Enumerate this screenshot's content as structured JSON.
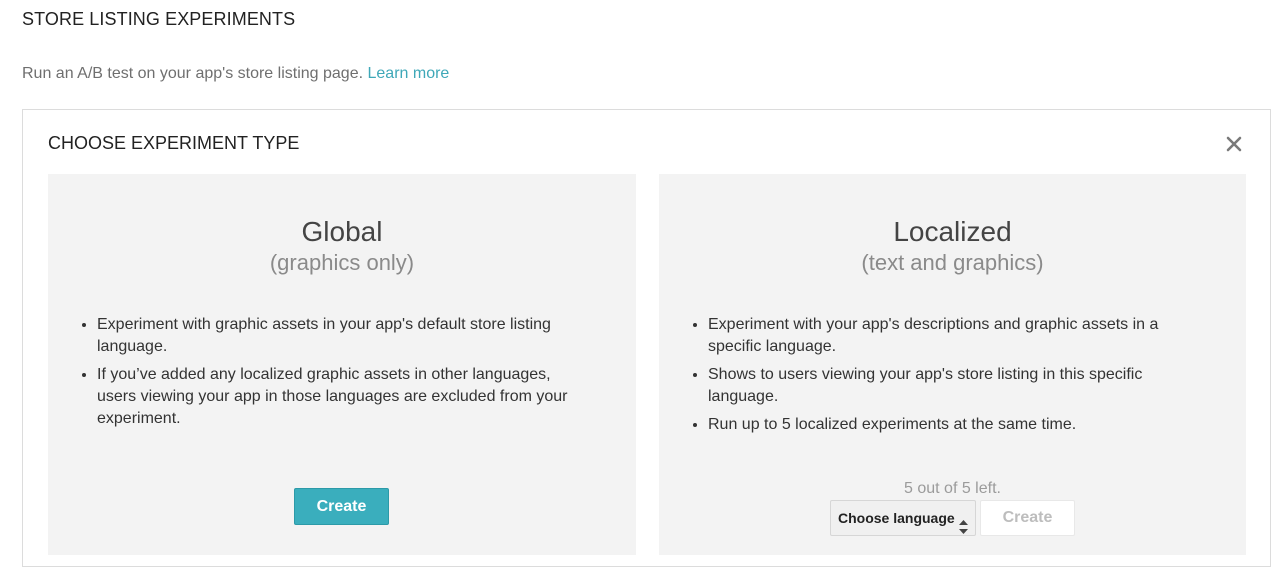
{
  "page": {
    "title": "STORE LISTING EXPERIMENTS",
    "subtitle": "Run an A/B test on your app's store listing page.",
    "learn_more": "Learn more",
    "link_color": "#3fa8b8"
  },
  "dialog": {
    "title": "CHOOSE EXPERIMENT TYPE",
    "close_icon": "close-icon"
  },
  "global": {
    "title": "Global",
    "subtitle": "(graphics only)",
    "bullets": [
      "Experiment with graphic assets in your app's default store listing language.",
      "If you’ve added any localized graphic assets in other languages, users viewing your app in those languages are excluded from your experiment."
    ],
    "create_label": "Create",
    "button_color": "#3aaebd"
  },
  "localized": {
    "title": "Localized",
    "subtitle": "(text and graphics)",
    "bullets": [
      "Experiment with your app's descriptions and graphic assets in a specific language.",
      "Shows to users viewing your app's store listing in this specific language.",
      "Run up to 5 localized experiments at the same time."
    ],
    "count_text": "5 out of 5 left.",
    "language_select": "Choose language",
    "create_label": "Create"
  }
}
